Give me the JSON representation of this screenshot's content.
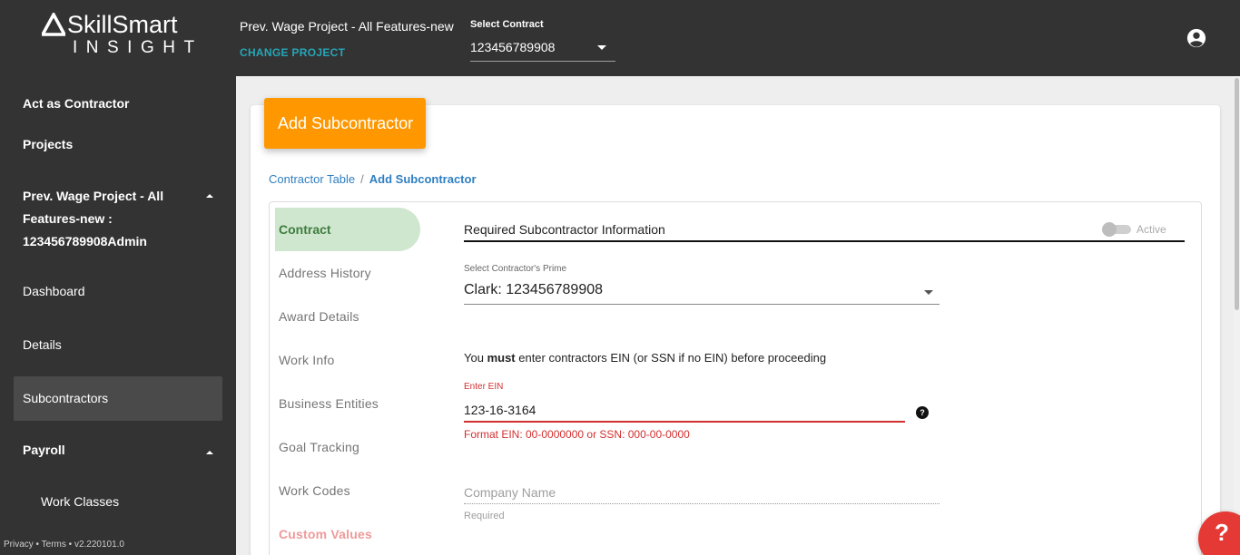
{
  "brand": {
    "name": "SkillSmart",
    "subtitle": "INSIGHT"
  },
  "header": {
    "project_title": "Prev. Wage Project - All Features-new",
    "change_project": "CHANGE PROJECT",
    "contract_label": "Select Contract",
    "contract_value": "123456789908",
    "user_icon": "account-circle-icon"
  },
  "sidebar": {
    "act_as": "Act as Contractor",
    "projects": "Projects",
    "project_group": "Prev. Wage Project - All Features-new : 123456789908Admin",
    "dashboard": "Dashboard",
    "details": "Details",
    "subcontractors": "Subcontractors",
    "payroll": "Payroll",
    "work_classes": "Work Classes",
    "footer": "Privacy • Terms • v2.220101.0"
  },
  "page": {
    "card_title": "Add Subcontractor",
    "breadcrumb": {
      "parent": "Contractor Table",
      "separator": "/",
      "current": "Add Subcontractor"
    }
  },
  "tabs": [
    {
      "label": "Contract",
      "active": true
    },
    {
      "label": "Address History"
    },
    {
      "label": "Award Details"
    },
    {
      "label": "Work Info"
    },
    {
      "label": "Business Entities"
    },
    {
      "label": "Goal Tracking"
    },
    {
      "label": "Work Codes"
    },
    {
      "label": "Custom Values"
    }
  ],
  "form": {
    "section_title": "Required Subcontractor Information",
    "active_label": "Active",
    "active": false,
    "prime_label": "Select Contractor's Prime",
    "prime_value": "Clark: 123456789908",
    "ein_note_pre": "You ",
    "ein_note_bold": "must",
    "ein_note_post": " enter contractors EIN (or SSN if no EIN) before proceeding",
    "ein_label": "Enter EIN",
    "ein_value": "123-16-3164",
    "ein_error": "Format EIN: 00-0000000 or SSN: 000-00-0000",
    "company_placeholder": "Company Name",
    "company_value": "",
    "required_hint": "Required"
  },
  "help_fab": "?",
  "colors": {
    "accent": "#ff9800",
    "sidebar": "#333333",
    "error": "#d32f2f",
    "link": "#2f7fc1",
    "active_tab": "#cfe6cf"
  }
}
